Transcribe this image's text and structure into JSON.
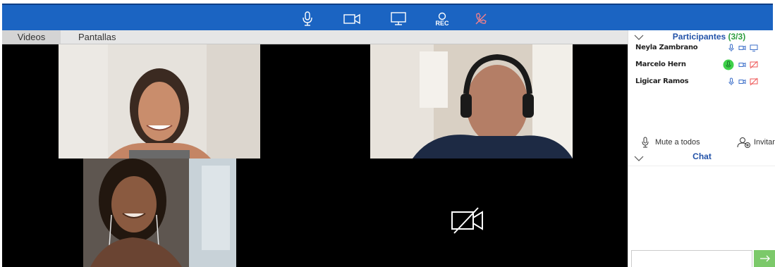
{
  "toolbar": {
    "buttons": [
      {
        "name": "microphone",
        "icon": "mic-icon"
      },
      {
        "name": "camera",
        "icon": "video-camera-icon"
      },
      {
        "name": "screen-share",
        "icon": "monitor-icon"
      },
      {
        "name": "record",
        "icon": "record-icon",
        "label": "REC"
      },
      {
        "name": "hang-up",
        "icon": "hangup-icon"
      }
    ],
    "colors": {
      "background": "#1b64c2",
      "hangup": "#f4808a"
    }
  },
  "tabs": [
    {
      "label": "Videos",
      "active": true
    },
    {
      "label": "Pantallas",
      "active": false
    }
  ],
  "videos": [
    {
      "name": "participant-video-1",
      "camera_off": false
    },
    {
      "name": "participant-video-2",
      "camera_off": false
    },
    {
      "name": "participant-video-3",
      "camera_off": false
    },
    {
      "name": "participant-video-4",
      "camera_off": true,
      "icon": "camera-off-icon"
    }
  ],
  "participants_panel": {
    "title": "Participantes",
    "count": "(3/3)",
    "items": [
      {
        "name": "Neyla Zambrano",
        "mic": "on",
        "camera": "on",
        "screen": "on"
      },
      {
        "name": "Marcelo Hern",
        "mic": "speaking",
        "camera": "on",
        "screen": "off"
      },
      {
        "name": "Ligicar Ramos",
        "mic": "on",
        "camera": "on",
        "screen": "off"
      }
    ],
    "mute_all_label": "Mute a todos",
    "invite_label": "Invitar"
  },
  "chat_panel": {
    "title": "Chat",
    "input_placeholder": "",
    "send_icon": "arrow-right-icon",
    "send_color": "#7cc96a"
  }
}
